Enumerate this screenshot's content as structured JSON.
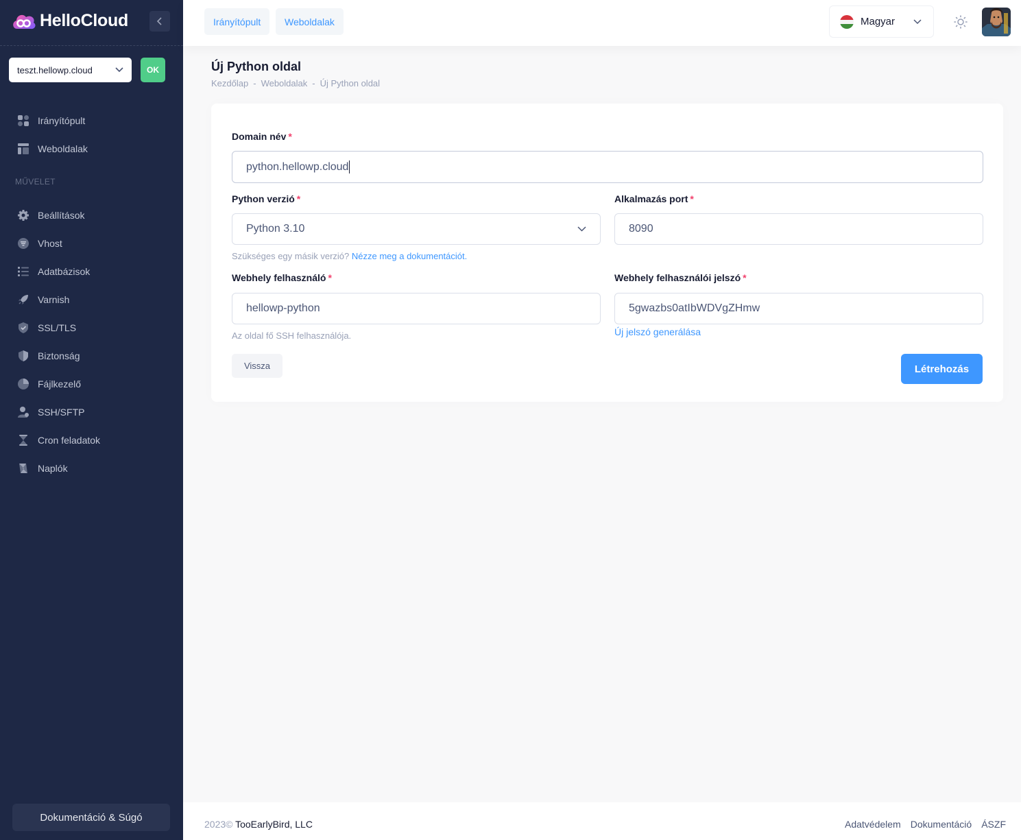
{
  "brand": {
    "name": "HelloCloud"
  },
  "sidebar": {
    "domain_select": "teszt.hellowp.cloud",
    "ok_label": "OK",
    "top_items": [
      {
        "label": "Irányítópult",
        "icon": "dashboard-icon"
      },
      {
        "label": "Weboldalak",
        "icon": "layout-icon"
      }
    ],
    "section_label": "MŰVELET",
    "items": [
      {
        "label": "Beállítások",
        "icon": "gear-icon"
      },
      {
        "label": "Vhost",
        "icon": "filter-icon"
      },
      {
        "label": "Adatbázisok",
        "icon": "list-icon"
      },
      {
        "label": "Varnish",
        "icon": "rocket-icon"
      },
      {
        "label": "SSL/TLS",
        "icon": "shield-check-icon"
      },
      {
        "label": "Biztonság",
        "icon": "shield-icon"
      },
      {
        "label": "Fájlkezelő",
        "icon": "file-icon"
      },
      {
        "label": "SSH/SFTP",
        "icon": "user-icon"
      },
      {
        "label": "Cron feladatok",
        "icon": "hourglass-icon"
      },
      {
        "label": "Naplók",
        "icon": "scroll-icon"
      }
    ],
    "docs_button": "Dokumentáció & Súgó"
  },
  "header": {
    "links": [
      "Irányítópult",
      "Weboldalak"
    ],
    "language": "Magyar"
  },
  "page": {
    "title": "Új Python oldal",
    "breadcrumb": [
      "Kezdőlap",
      "Weboldalak",
      "Új Python oldal"
    ]
  },
  "form": {
    "domain_label": "Domain név",
    "domain_value": "python.hellowp.cloud",
    "python_label": "Python verzió",
    "python_value": "Python 3.10",
    "python_hint": "Szükséges egy másik verzió?",
    "python_hint_link": "Nézze meg a dokumentációt.",
    "port_label": "Alkalmazás port",
    "port_value": "8090",
    "user_label": "Webhely felhasználó",
    "user_value": "hellowp-python",
    "user_hint": "Az oldal fő SSH felhasználója.",
    "password_label": "Webhely felhasználói jelszó",
    "password_value": "5gwazbs0atIbWDVgZHmw",
    "password_link": "Új jelszó generálása",
    "back_button": "Vissza",
    "create_button": "Létrehozás"
  },
  "footer": {
    "year": "2023©",
    "company": "TooEarlyBird, LLC",
    "links": [
      "Adatvédelem",
      "Dokumentáció",
      "ÁSZF"
    ]
  },
  "colors": {
    "sidebar_bg": "#1e2845",
    "primary": "#3e97ff",
    "success": "#50cd89",
    "required": "#f1416c"
  }
}
